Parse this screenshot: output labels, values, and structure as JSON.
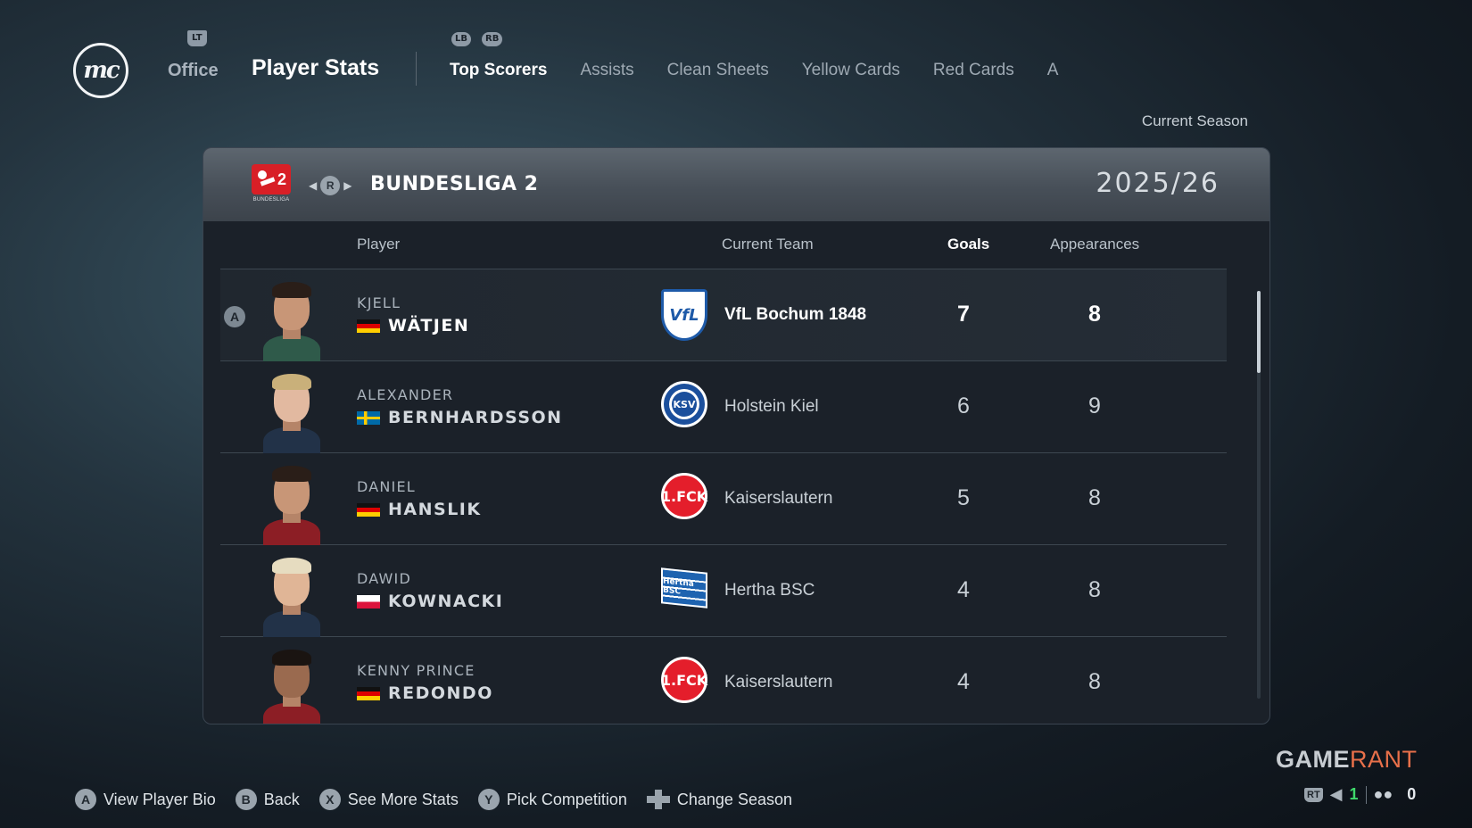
{
  "logo": {
    "text": "mc"
  },
  "nav": {
    "lt_chip": "LT",
    "lb_chip": "LB",
    "rb_chip": "RB",
    "office": "Office",
    "title": "Player Stats",
    "tabs": [
      "Top Scorers",
      "Assists",
      "Clean Sheets",
      "Yellow Cards",
      "Red Cards",
      "A"
    ],
    "active_tab": "Top Scorers"
  },
  "season_label": "Current Season",
  "league": {
    "badge_number": "2",
    "badge_caption": "BUNDESLIGA",
    "selector_button": "R",
    "name": "BUNDESLIGA 2",
    "season": "2025/26"
  },
  "columns": {
    "player": "Player",
    "team": "Current Team",
    "goals": "Goals",
    "apps": "Appearances"
  },
  "rows": [
    {
      "marker": "A",
      "first": "KJELL",
      "last": "WÄTJEN",
      "nation": "Germany",
      "team": "VfL Bochum 1848",
      "crest_text": "VfL",
      "goals": "7",
      "apps": "8",
      "selected": true
    },
    {
      "first": "ALEXANDER",
      "last": "BERNHARDSSON",
      "nation": "Sweden",
      "team": "Holstein Kiel",
      "crest_text": "KSV",
      "goals": "6",
      "apps": "9"
    },
    {
      "first": "DANIEL",
      "last": "HANSLIK",
      "nation": "Germany",
      "team": "Kaiserslautern",
      "crest_text": "1.FCK",
      "goals": "5",
      "apps": "8"
    },
    {
      "first": "DAWID",
      "last": "KOWNACKI",
      "nation": "Poland",
      "team": "Hertha BSC",
      "crest_text": "Hertha BSC",
      "goals": "4",
      "apps": "8"
    },
    {
      "first": "KENNY PRINCE",
      "last": "REDONDO",
      "nation": "Germany",
      "team": "Kaiserslautern",
      "crest_text": "1.FCK",
      "goals": "4",
      "apps": "8"
    }
  ],
  "hints": [
    {
      "button": "A",
      "label": "View Player Bio"
    },
    {
      "button": "B",
      "label": "Back"
    },
    {
      "button": "X",
      "label": "See More Stats"
    },
    {
      "button": "Y",
      "label": "Pick Competition"
    },
    {
      "button": "dpad",
      "label": "Change Season"
    }
  ],
  "watermark": {
    "game": "GAME",
    "rant": "RANT"
  },
  "status": {
    "rt_chip": "RT",
    "voice_count": "1",
    "party_count": "0"
  },
  "colors": {
    "background": "#1b2129",
    "accent_green": "#3fd86b",
    "bochum_blue": "#1e5aa8",
    "fck_red": "#e41e2b"
  }
}
